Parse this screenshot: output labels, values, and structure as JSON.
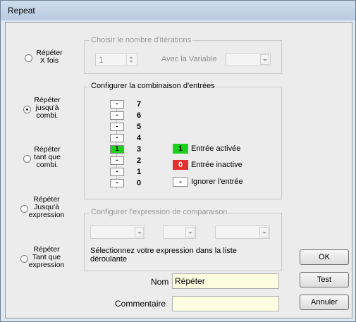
{
  "window": {
    "title": "Repeat"
  },
  "modes": [
    {
      "label_lines": [
        "Répéter",
        "X fois"
      ],
      "checked": false
    },
    {
      "label_lines": [
        "Répéter",
        "jusqu'à",
        "combi."
      ],
      "checked": true
    },
    {
      "label_lines": [
        "Répéter",
        "tant que",
        "combi."
      ],
      "checked": false
    },
    {
      "label_lines": [
        "Répéter",
        "Jusqu'à",
        "expression"
      ],
      "checked": false
    },
    {
      "label_lines": [
        "Répéter",
        "Tant que",
        "expression"
      ],
      "checked": false
    }
  ],
  "iterations": {
    "legend": "Choisir le nombre d'itérations",
    "value": "1",
    "variable_label": "Avec la Variable"
  },
  "combination": {
    "legend": "Configurer la combinaison d'entrées",
    "bits": [
      {
        "number": "7",
        "state": "-"
      },
      {
        "number": "6",
        "state": "-"
      },
      {
        "number": "5",
        "state": "-"
      },
      {
        "number": "4",
        "state": "-"
      },
      {
        "number": "3",
        "state": "1"
      },
      {
        "number": "2",
        "state": "-"
      },
      {
        "number": "1",
        "state": "-"
      },
      {
        "number": "0",
        "state": "-"
      }
    ],
    "legend_items": [
      {
        "symbol": "1",
        "label": "Entrée activée",
        "color": "#19d219",
        "text_color": "#000000"
      },
      {
        "symbol": "0",
        "label": "Entrée inactive",
        "color": "#e53030",
        "text_color": "#ffffff"
      },
      {
        "symbol": "-",
        "label": "Ignorer l'entrée",
        "color": "#ffffff",
        "text_color": "#000000"
      }
    ]
  },
  "expression": {
    "legend": "Configurer l'expression de comparaison",
    "hint": "Sélectionnez votre expression dans la liste déroulante"
  },
  "form": {
    "name_label": "Nom",
    "name_value": "Répéter",
    "comment_label": "Commentaire",
    "comment_value": ""
  },
  "buttons": {
    "ok": "OK",
    "test": "Test",
    "cancel": "Annuler"
  }
}
